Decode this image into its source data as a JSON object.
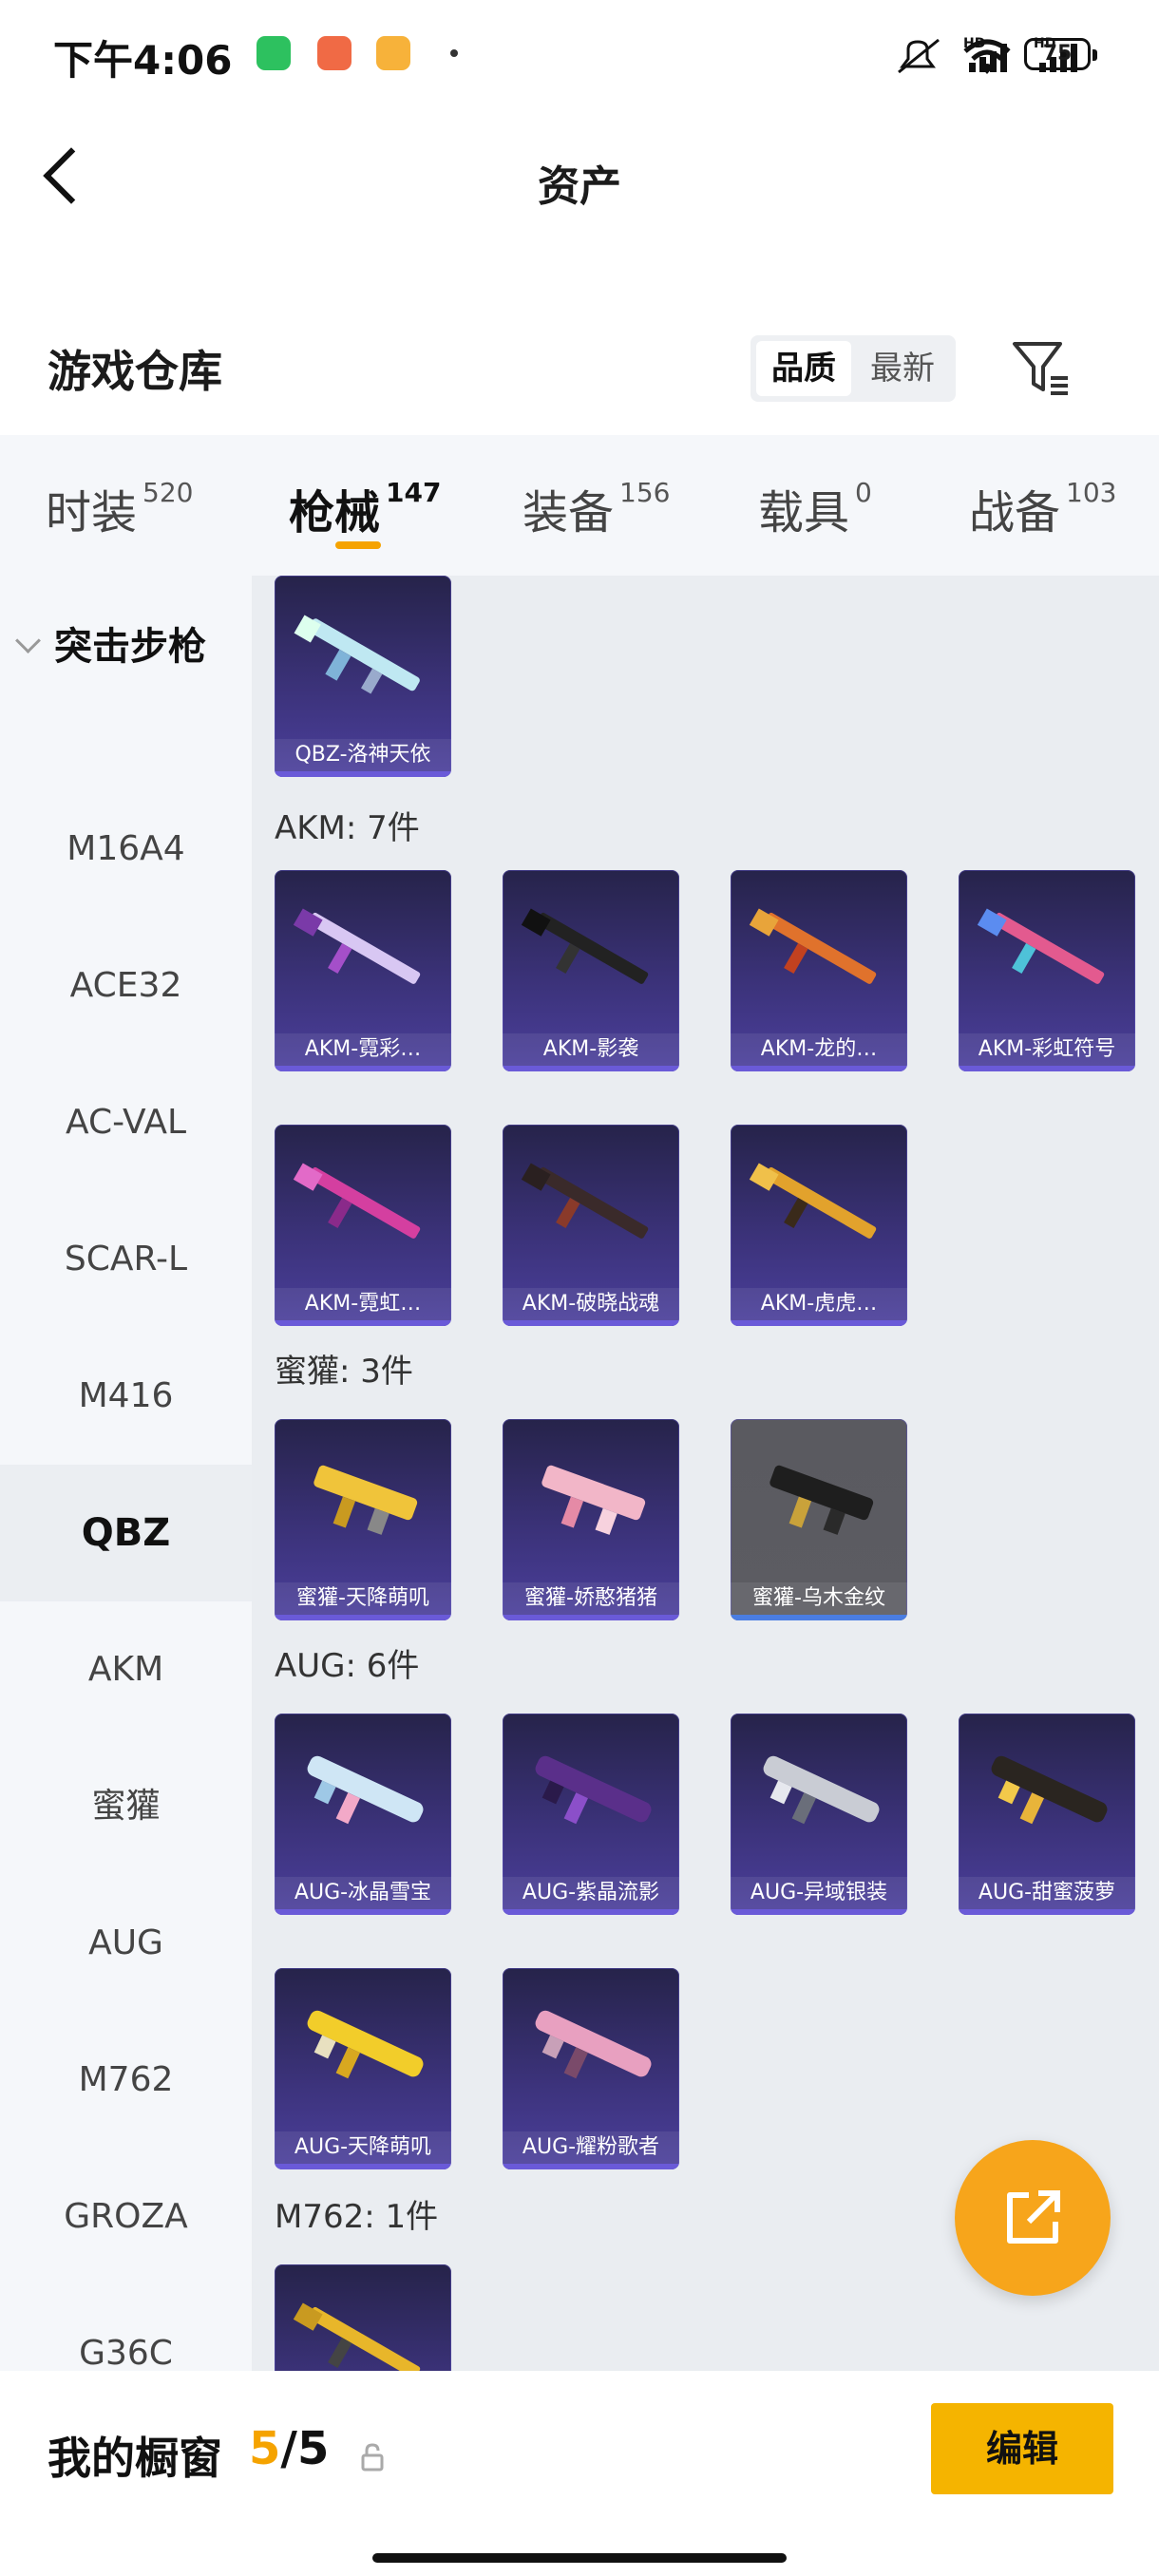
{
  "status_bar": {
    "time": "下午4:06",
    "hd1": "HD",
    "hd2": "HD",
    "battery": "75"
  },
  "header": {
    "title": "资产",
    "back_icon": "chevron-left-icon"
  },
  "warehouse": {
    "title": "游戏仓库",
    "sort_options": [
      "品质",
      "最新"
    ],
    "selected_sort": "品质",
    "filter_icon": "filter-icon"
  },
  "tabs": [
    {
      "label": "时装",
      "count": "520"
    },
    {
      "label": "枪械",
      "count": "147"
    },
    {
      "label": "装备",
      "count": "156"
    },
    {
      "label": "载具",
      "count": "0"
    },
    {
      "label": "战备",
      "count": "103"
    }
  ],
  "active_tab": "枪械",
  "sidebar": {
    "category": "突击步枪",
    "items": [
      "M16A4",
      "ACE32",
      "AC-VAL",
      "SCAR-L",
      "M416",
      "QBZ",
      "AKM",
      "蜜獾",
      "AUG",
      "M762",
      "GROZA",
      "G36C"
    ],
    "active": "QBZ"
  },
  "groups": {
    "qbz": {
      "cards": [
        "QBZ-洛神天依"
      ]
    },
    "akm": {
      "label": "AKM: 7件",
      "cards": [
        "AKM-霓彩…",
        "AKM-影袭",
        "AKM-龙的…",
        "AKM-彩虹符号",
        "AKM-霓虹…",
        "AKM-破晓战魂",
        "AKM-虎虎…"
      ]
    },
    "honeybadger": {
      "label": "蜜獾: 3件",
      "cards": [
        "蜜獾-天降萌叽",
        "蜜獾-娇憨猪猪",
        "蜜獾-乌木金纹"
      ]
    },
    "aug": {
      "label": "AUG: 6件",
      "cards": [
        "AUG-冰晶雪宝",
        "AUG-紫晶流影",
        "AUG-异域银装",
        "AUG-甜蜜菠萝",
        "AUG-天降萌叽",
        "AUG-耀粉歌者"
      ]
    },
    "m762": {
      "label": "M762: 1件"
    }
  },
  "fab_icon": "share-icon",
  "bottom": {
    "label": "我的橱窗",
    "count_used": "5",
    "count_total": "/5",
    "lock_icon": "lock-icon",
    "edit_label": "编辑"
  },
  "colors": {
    "accent": "#f5a300",
    "card_bg": "#3b3279",
    "button": "#f5b400"
  }
}
